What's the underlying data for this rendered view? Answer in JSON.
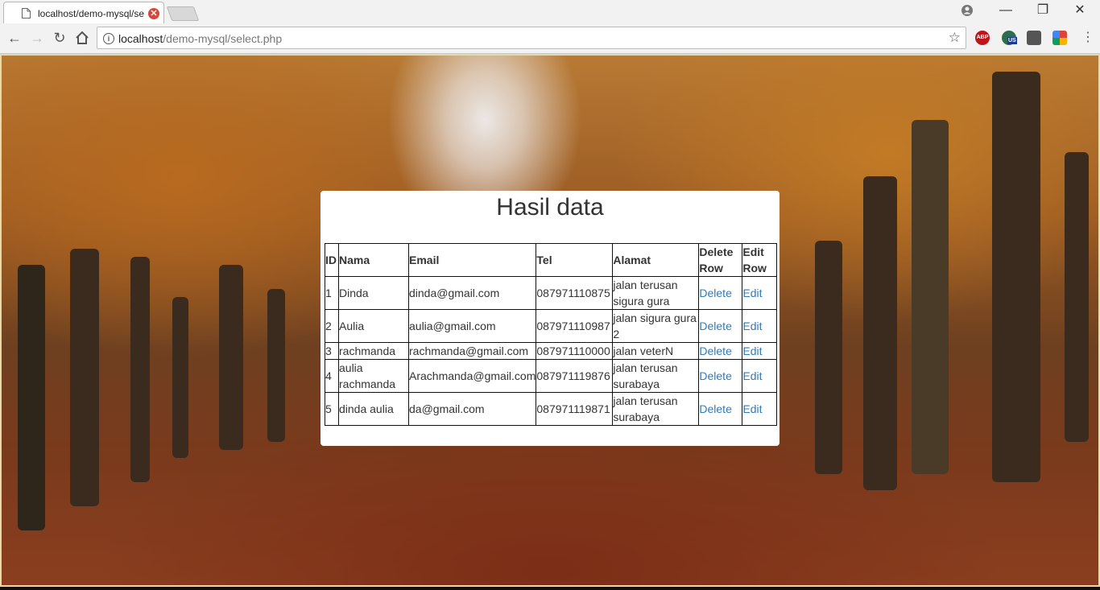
{
  "browser": {
    "tab_title": "localhost/demo-mysql/select.php",
    "url_host": "localhost",
    "url_path": "/demo-mysql/select.php",
    "extensions": [
      "ABP",
      "US"
    ]
  },
  "page": {
    "title": "Hasil data",
    "columns": [
      "ID",
      "Nama",
      "Email",
      "Tel",
      "Alamat",
      "Delete Row",
      "Edit Row"
    ],
    "rows": [
      {
        "id": "1",
        "nama": "Dinda",
        "email": "dinda@gmail.com",
        "tel": "087971110875",
        "alamat": "jalan terusan sigura gura",
        "delete": "Delete",
        "edit": "Edit"
      },
      {
        "id": "2",
        "nama": "Aulia",
        "email": "aulia@gmail.com",
        "tel": "087971110987",
        "alamat": "jalan sigura gura 2",
        "delete": "Delete",
        "edit": "Edit"
      },
      {
        "id": "3",
        "nama": "rachmanda",
        "email": "rachmanda@gmail.com",
        "tel": "087971110000",
        "alamat": "jalan veterN",
        "delete": "Delete",
        "edit": "Edit"
      },
      {
        "id": "4",
        "nama": "aulia rachmanda",
        "email": "Arachmanda@gmail.com",
        "tel": "087971119876",
        "alamat": "jalan terusan surabaya",
        "delete": "Delete",
        "edit": "Edit"
      },
      {
        "id": "5",
        "nama": "dinda aulia",
        "email": "da@gmail.com",
        "tel": "087971119871",
        "alamat": "jalan terusan surabaya",
        "delete": "Delete",
        "edit": "Edit"
      }
    ]
  },
  "colors": {
    "link": "#337ab7",
    "close_badge": "#db4437"
  }
}
